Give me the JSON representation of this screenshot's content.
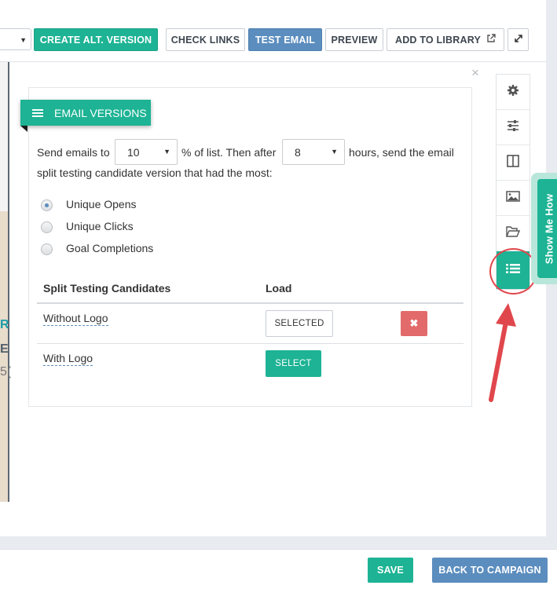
{
  "toolbar": {
    "create_alt_version": "CREATE ALT. VERSION",
    "check_links": "CHECK LINKS",
    "test_email": "TEST EMAIL",
    "preview": "PREVIEW",
    "add_to_library": "ADD TO LIBRARY"
  },
  "panel": {
    "title": "EMAIL VERSIONS",
    "send_emails_to": "Send emails to",
    "percent_value": "10",
    "percent_of_list": "% of list. Then after",
    "hours_value": "8",
    "hours_send": "hours, send the email",
    "line2": "split testing candidate version that had the most:",
    "radios": [
      {
        "label": "Unique Opens",
        "checked": true
      },
      {
        "label": "Unique Clicks",
        "checked": false
      },
      {
        "label": "Goal Completions",
        "checked": false
      }
    ],
    "table": {
      "col_candidates": "Split Testing Candidates",
      "col_load": "Load",
      "rows": [
        {
          "name": "Without Logo",
          "button": "SELECTED"
        },
        {
          "name": "With Logo",
          "button": "SELECT"
        }
      ]
    },
    "close_glyph": "×",
    "delete_glyph": "✖"
  },
  "preview_strip": {
    "letters": [
      "R",
      "E",
      "5("
    ]
  },
  "rail": {
    "icons": [
      "gear-icon",
      "sliders-icon",
      "columns-icon",
      "image-icon",
      "folder-open-icon",
      "list-icon"
    ],
    "active": "list-icon"
  },
  "show_me_how": "Show Me How",
  "bottom": {
    "save": "SAVE",
    "back_to_campaign": "BACK TO CAMPAIGN"
  },
  "colors": {
    "green": "#1db394",
    "blue": "#5b8dbe",
    "red": "#e26a6a",
    "annotation_red": "#e0474c"
  }
}
